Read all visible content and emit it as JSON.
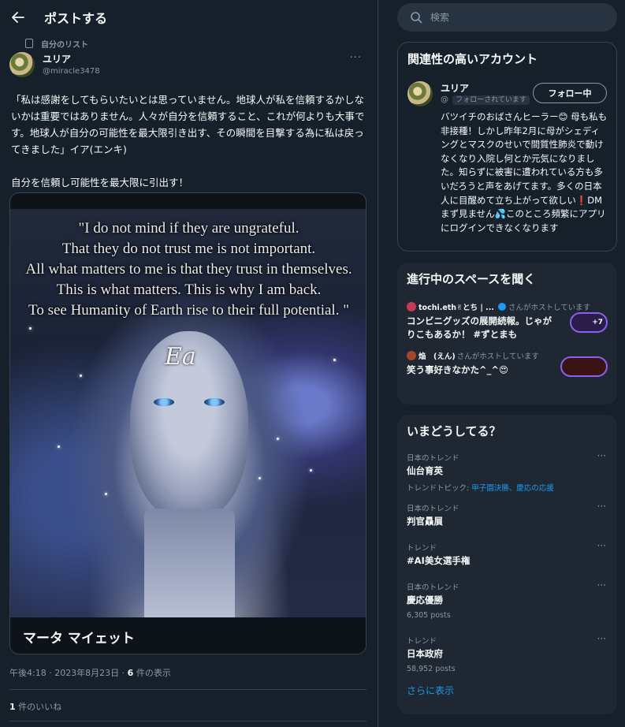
{
  "header": {
    "title": "ポストする"
  },
  "list_tag": "自分のリスト",
  "post": {
    "author_name": "ユリア",
    "author_handle": "@miracle3478",
    "text_p1": "「私は感謝をしてもらいたいとは思っていません。地球人が私を信頼するかしないかは重要ではありません。人々が自分を信頼すること、これが何よりも大事です。地球人が自分の可能性を最大限引き出す、その瞬間を目撃する為に私は戻ってきました」イア(エンキ)",
    "text_p2": "自分を信頼し可能性を最大限に引出す！",
    "image_quote": [
      "\"I do not mind if they are ungrateful.",
      "That they do not trust me is not important.",
      "All what matters to me is that they trust in themselves.",
      "This is what matters. This is why I am back.",
      "To see Humanity of Earth rise to their full potential. \""
    ],
    "image_signature": "Ea",
    "media_caption": "マータ マイェット",
    "meta_time": "午後4:18 · 2023年8月23日 · ",
    "meta_views_count": "6",
    "meta_views_label": " 件の表示",
    "likes_count": "1",
    "likes_label": " 件のいいね"
  },
  "search": {
    "placeholder": "検索"
  },
  "related": {
    "title": "関連性の高いアカウント",
    "name": "ユリア",
    "handle_prefix": "@",
    "follows_you": "フォローされています",
    "follow_button": "フォロー中",
    "bio": "バツイチのおばさんヒーラー😊 母も私も非接種！しかし昨年2月に母がシェディングとマスクのせいで間質性肺炎で動けなくなり入院し何とか元気になりました。知らずに被害に遭われている方も多いだろうと声をあげてます。多くの日本人に目醒めて立ち上がって欲しい❗DMまず見ません💦このところ頻繁にアプリにログインできなくなります"
  },
  "spaces": {
    "title": "進行中のスペースを聞く",
    "items": [
      {
        "host": "tochi.eth✌とち | ...",
        "host_suffix": "さんがホストしています",
        "title": "コンビニグッズの展開続報。じゃがりこもあるか！ #ずとまも",
        "extra": "+7"
      },
      {
        "host": "焔　(えん)",
        "host_suffix": "さんがホストしています",
        "title": "笑う事好きなかた^_^😍",
        "extra": ""
      }
    ]
  },
  "trends": {
    "title": "いまどうしてる？",
    "items": [
      {
        "category": "日本のトレンド",
        "name": "仙台育英",
        "extra_label": "トレンドトピック: ",
        "extra_links": "甲子園決勝、慶応の応援"
      },
      {
        "category": "日本のトレンド",
        "name": "判官贔屓"
      },
      {
        "category": "トレンド",
        "name": "#AI美女選手権"
      },
      {
        "category": "日本のトレンド",
        "name": "慶応優勝",
        "posts": "6,305 posts"
      },
      {
        "category": "トレンド",
        "name": "日本政府",
        "posts": "58,952 posts"
      }
    ],
    "show_more": "さらに表示"
  },
  "colors": {
    "background": "#15202b",
    "accent": "#1d9bf0",
    "border": "#38444d",
    "muted": "#8b98a5"
  }
}
